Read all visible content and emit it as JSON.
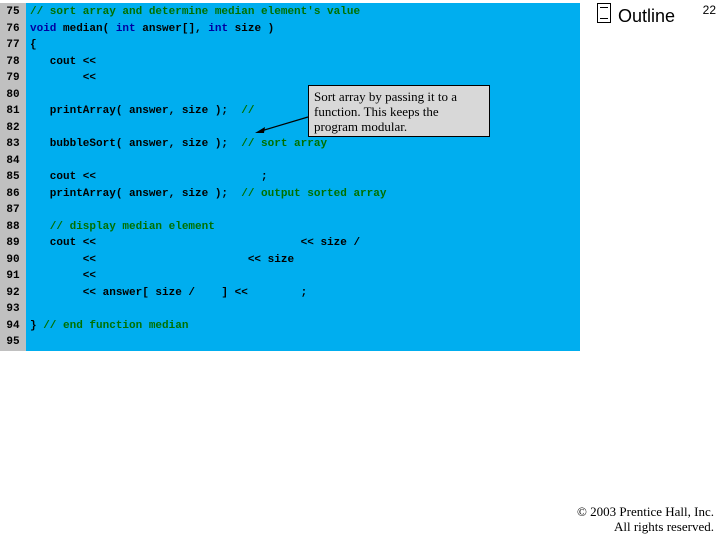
{
  "page_number": "22",
  "outline_label": "Outline",
  "line_numbers": [
    "75",
    "76",
    "77",
    "78",
    "79",
    "80",
    "81",
    "82",
    "83",
    "84",
    "85",
    "86",
    "87",
    "88",
    "89",
    "90",
    "91",
    "92",
    "93",
    "94",
    "95"
  ],
  "code": {
    "l75": "// sort array and determine median element's value",
    "l76_a": "void",
    "l76_b": " median( ",
    "l76_c": "int",
    "l76_d": " answer[], ",
    "l76_e": "int",
    "l76_f": " size )",
    "l77": "{",
    "l78": "   cout << ",
    "l79": "        << ",
    "l81_a": "   printArray( answer, size );  ",
    "l81_b": "// ",
    "l83_a": "   bubbleSort( answer, size );  ",
    "l83_b": "// sort array",
    "l85": "   cout <<                         ;",
    "l86_a": "   printArray( answer, size );  ",
    "l86_b": "// output sorted array",
    "l88": "   // display median element",
    "l89": "   cout <<                               << size / ",
    "l90": "        <<                       << size",
    "l91": "        << ",
    "l92": "        << answer[ size /    ] <<        ;",
    "l94_a": "} ",
    "l94_b": "// end function median"
  },
  "callout_text": "Sort array by passing it to a function. This keeps the program modular.",
  "copyright_line1": "© 2003 Prentice Hall, Inc.",
  "copyright_line2": "All rights reserved."
}
